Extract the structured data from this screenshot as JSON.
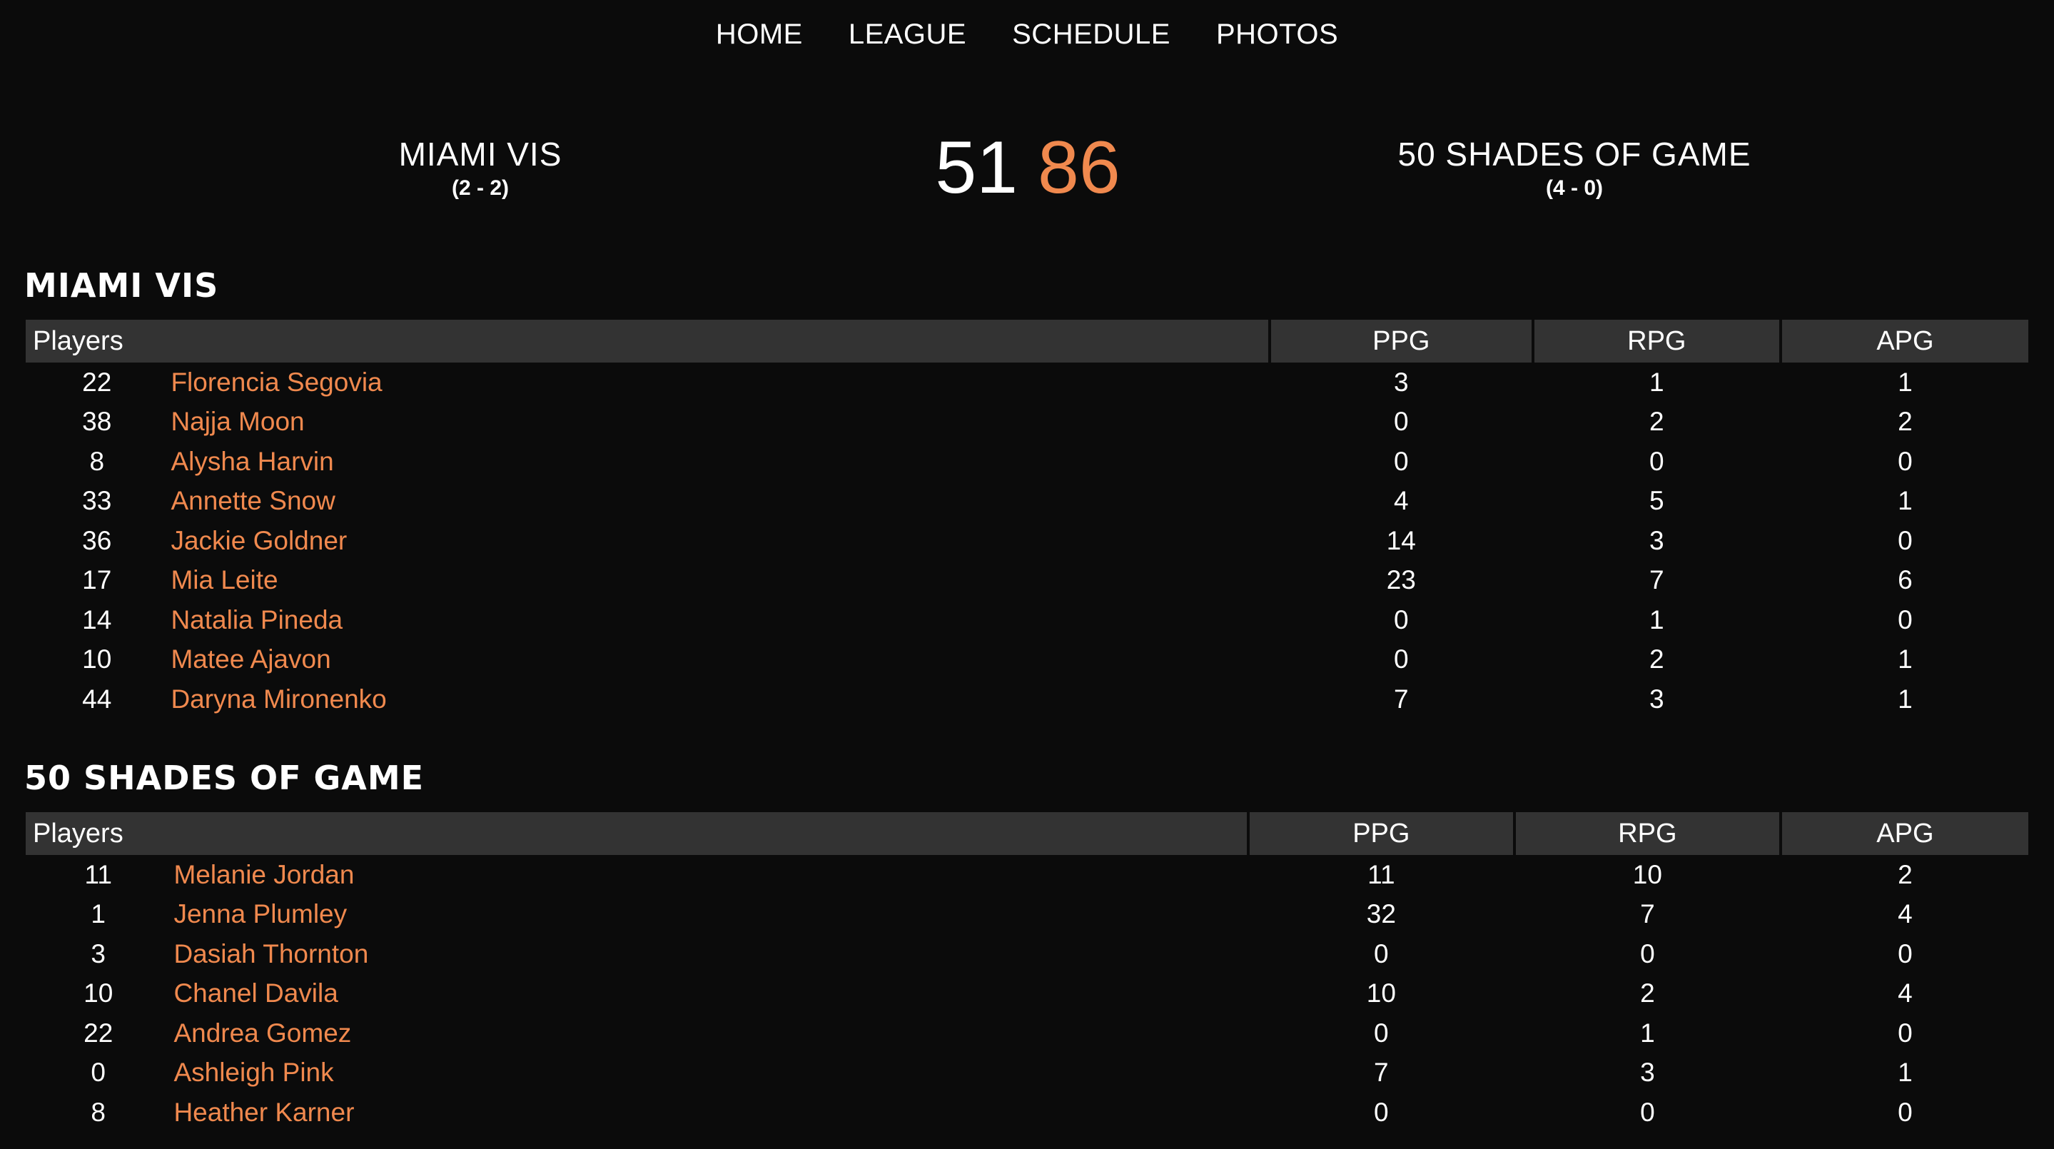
{
  "nav": {
    "items": [
      "HOME",
      "LEAGUE",
      "SCHEDULE",
      "PHOTOS"
    ]
  },
  "game": {
    "home": {
      "name": "MIAMI VIS",
      "record": "(2 - 2)",
      "score": "51"
    },
    "away": {
      "name": "50 SHADES OF GAME",
      "record": "(4 - 0)",
      "score": "86"
    }
  },
  "table_headers": {
    "players": "Players",
    "ppg": "PPG",
    "rpg": "RPG",
    "apg": "APG"
  },
  "rosters": {
    "home": {
      "title": "MIAMI VIS",
      "players": [
        {
          "number": "22",
          "name": "Florencia Segovia",
          "ppg": "3",
          "rpg": "1",
          "apg": "1"
        },
        {
          "number": "38",
          "name": "Najja Moon",
          "ppg": "0",
          "rpg": "2",
          "apg": "2"
        },
        {
          "number": "8",
          "name": "Alysha Harvin",
          "ppg": "0",
          "rpg": "0",
          "apg": "0"
        },
        {
          "number": "33",
          "name": "Annette Snow",
          "ppg": "4",
          "rpg": "5",
          "apg": "1"
        },
        {
          "number": "36",
          "name": "Jackie Goldner",
          "ppg": "14",
          "rpg": "3",
          "apg": "0"
        },
        {
          "number": "17",
          "name": "Mia Leite",
          "ppg": "23",
          "rpg": "7",
          "apg": "6"
        },
        {
          "number": "14",
          "name": "Natalia Pineda",
          "ppg": "0",
          "rpg": "1",
          "apg": "0"
        },
        {
          "number": "10",
          "name": "Matee Ajavon",
          "ppg": "0",
          "rpg": "2",
          "apg": "1"
        },
        {
          "number": "44",
          "name": "Daryna Mironenko",
          "ppg": "7",
          "rpg": "3",
          "apg": "1"
        }
      ]
    },
    "away": {
      "title": "50 SHADES OF GAME",
      "players": [
        {
          "number": "11",
          "name": "Melanie Jordan",
          "ppg": "11",
          "rpg": "10",
          "apg": "2"
        },
        {
          "number": "1",
          "name": "Jenna Plumley",
          "ppg": "32",
          "rpg": "7",
          "apg": "4"
        },
        {
          "number": "3",
          "name": "Dasiah Thornton",
          "ppg": "0",
          "rpg": "0",
          "apg": "0"
        },
        {
          "number": "10",
          "name": "Chanel Davila",
          "ppg": "10",
          "rpg": "2",
          "apg": "4"
        },
        {
          "number": "22",
          "name": "Andrea Gomez",
          "ppg": "0",
          "rpg": "1",
          "apg": "0"
        },
        {
          "number": "0",
          "name": "Ashleigh Pink",
          "ppg": "7",
          "rpg": "3",
          "apg": "1"
        },
        {
          "number": "8",
          "name": "Heather Karner",
          "ppg": "0",
          "rpg": "0",
          "apg": "0"
        }
      ]
    }
  },
  "colors": {
    "background": "#0b0b0b",
    "accent": "#f0894e",
    "header_bg": "#333333",
    "text": "#ffffff"
  }
}
